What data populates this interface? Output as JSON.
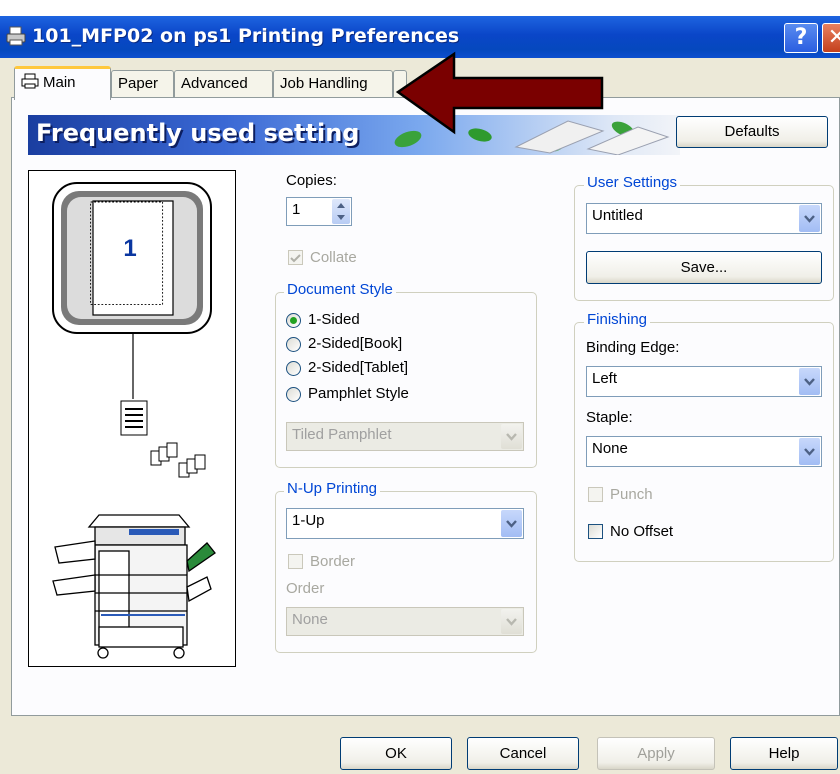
{
  "window": {
    "title": "101_MFP02 on ps1 Printing Preferences",
    "help_label": "?",
    "close_label": "✕"
  },
  "tabs": [
    {
      "label": "Main",
      "active": true
    },
    {
      "label": "Paper"
    },
    {
      "label": "Advanced"
    },
    {
      "label": "Job Handling"
    }
  ],
  "banner": {
    "title": "Frequently used setting"
  },
  "defaults_label": "Defaults",
  "preview": {
    "page_number": "1"
  },
  "copies": {
    "label": "Copies:",
    "value": "1"
  },
  "collate": {
    "label": "Collate",
    "checked": true,
    "enabled": false
  },
  "document_style": {
    "legend": "Document Style",
    "options": [
      "1-Sided",
      "2-Sided[Book]",
      "2-Sided[Tablet]",
      "Pamphlet Style"
    ],
    "selected": "1-Sided",
    "pamphlet_select": "Tiled Pamphlet"
  },
  "nup": {
    "legend": "N-Up Printing",
    "value": "1-Up",
    "border_label": "Border",
    "order_label": "Order",
    "order_value": "None"
  },
  "user_settings": {
    "legend": "User Settings",
    "value": "Untitled",
    "save_label": "Save..."
  },
  "finishing": {
    "legend": "Finishing",
    "binding_label": "Binding Edge:",
    "binding_value": "Left",
    "staple_label": "Staple:",
    "staple_value": "None",
    "punch_label": "Punch",
    "no_offset_label": "No Offset"
  },
  "footer": {
    "ok": "OK",
    "cancel": "Cancel",
    "apply": "Apply",
    "help": "Help"
  },
  "colors": {
    "titlebar": "#0a46c8",
    "arrow": "#7a0000",
    "accent_text": "#0046d5"
  }
}
